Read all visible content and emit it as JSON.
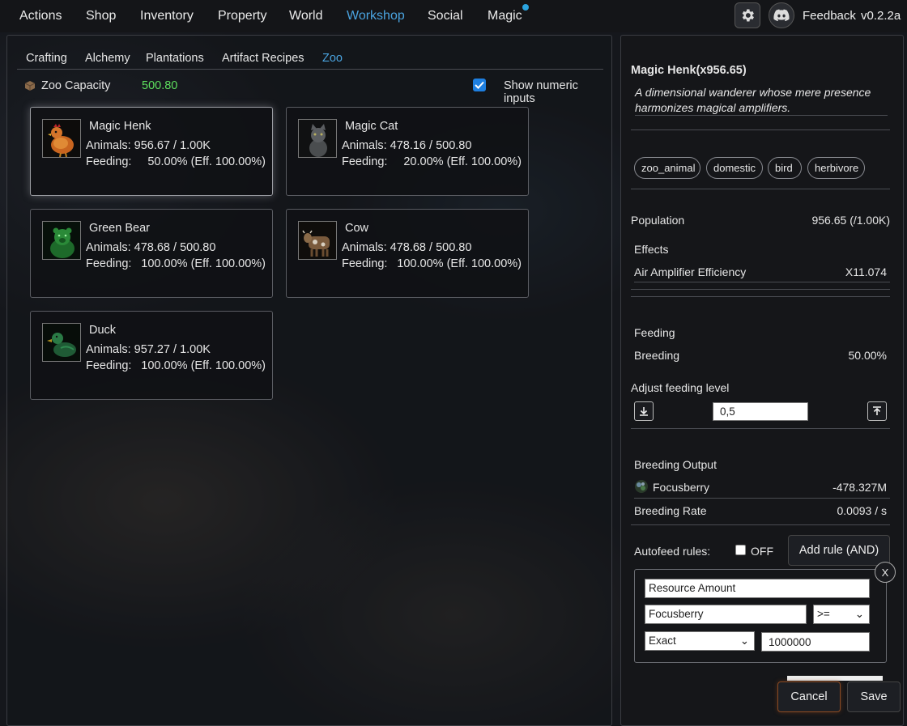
{
  "nav": {
    "items": [
      "Actions",
      "Shop",
      "Inventory",
      "Property",
      "World",
      "Workshop",
      "Social",
      "Magic"
    ],
    "active": "Workshop",
    "feedback": "Feedback",
    "version": "v0.2.2a"
  },
  "subtabs": [
    "Crafting",
    "Alchemy",
    "Plantations",
    "Artifact Recipes",
    "Zoo"
  ],
  "zoo": {
    "capacity_label": "Zoo Capacity",
    "capacity_value": "500.80",
    "show_numeric_label": "Show numeric inputs",
    "show_numeric_checked": true
  },
  "animals": [
    {
      "name": "Magic  Henk",
      "animals": "Animals: 956.67 / 1.00K",
      "feeding_label": "Feeding:",
      "feeding": "50.00% (Eff. 100.00%)",
      "icon": "chicken-icon",
      "selected": true
    },
    {
      "name": "Magic Cat",
      "animals": "Animals: 478.16 / 500.80",
      "feeding_label": "Feeding:",
      "feeding": "20.00% (Eff. 100.00%)",
      "icon": "cat-icon",
      "selected": false
    },
    {
      "name": "Green  Bear",
      "animals": "Animals: 478.68 / 500.80",
      "feeding_label": "Feeding:",
      "feeding": "100.00% (Eff. 100.00%)",
      "icon": "bear-icon",
      "selected": false
    },
    {
      "name": "Cow",
      "animals": "Animals: 478.68 / 500.80",
      "feeding_label": "Feeding:",
      "feeding": "100.00% (Eff. 100.00%)",
      "icon": "cow-icon",
      "selected": false
    },
    {
      "name": "Duck",
      "animals": "Animals: 957.27 / 1.00K",
      "feeding_label": "Feeding:",
      "feeding": "100.00% (Eff. 100.00%)",
      "icon": "duck-icon",
      "selected": false
    }
  ],
  "detail": {
    "title": "Magic Henk(x956.65)",
    "description": "A dimensional wanderer whose mere presence harmonizes magical amplifiers.",
    "tags": [
      "zoo_animal",
      "domestic",
      "bird",
      "herbivore"
    ],
    "population_label": "Population",
    "population_value": "956.65 (/1.00K)",
    "effects_label": "Effects",
    "effect_name": "Air Amplifier  Efficiency",
    "effect_value": "X11.074",
    "feeding_label": "Feeding",
    "breeding_label": "Breeding",
    "breeding_value": "50.00%",
    "adjust_label": "Adjust feeding level",
    "adjust_value": "0,5",
    "output_label": "Breeding Output",
    "output_item": "Focusberry",
    "output_value": "-478.327M",
    "rate_label": "Breeding  Rate",
    "rate_value": "0.0093 / s",
    "autofeed_label": "Autofeed rules:",
    "autofeed_state": "OFF",
    "add_rule": "Add rule (AND)",
    "remove_rule": "X",
    "rule": {
      "type": "Resource Amount",
      "resource": "Focusberry",
      "operator": ">=",
      "mode": "Exact",
      "amount": "1000000"
    },
    "cancel": "Cancel",
    "save": "Save"
  },
  "colors": {
    "accent": "#4aa3df",
    "capacity": "#5ddf5d",
    "checkbox": "#1e7fe0",
    "cancel_border": "#8a4a22"
  }
}
